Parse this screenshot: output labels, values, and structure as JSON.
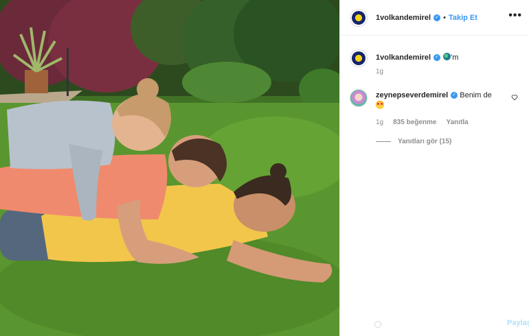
{
  "post": {
    "username": "1volkandemirel",
    "follow_label": "Takip Et",
    "separator": "•",
    "more_label": "•••"
  },
  "caption": {
    "username": "1volkandemirel",
    "text_suffix": "'m",
    "time": "1g"
  },
  "comment": {
    "username": "zeynepseverdemirel",
    "text": "Benim de",
    "time": "1g",
    "likes": "835 beğenme",
    "reply_label": "Yanıtla",
    "view_replies": "Yanıtları gör (15)"
  },
  "footer": {
    "share_label": "Paylaş"
  },
  "icons": {
    "verified": "verified-badge-icon",
    "more": "more-options-icon",
    "heart": "heart-icon",
    "globe": "globe-emoji-icon",
    "heart_eyes": "heart-eyes-emoji-icon"
  },
  "colors": {
    "accent": "#3897f0",
    "text": "#262626",
    "muted": "#8e8e8e",
    "border": "#efefef"
  }
}
